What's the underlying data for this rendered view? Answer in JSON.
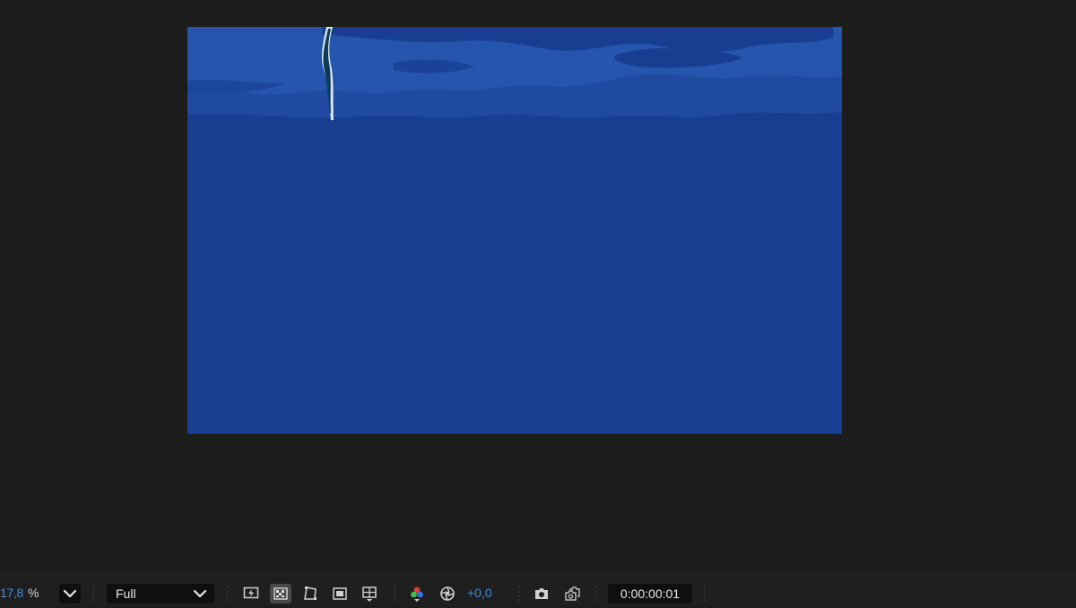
{
  "viewer": {
    "background": "#1d1d1d",
    "composition_color": "#173e91"
  },
  "toolbar": {
    "zoom_value": "17,8",
    "zoom_unit": "%",
    "resolution": "Full",
    "exposure": "+0,0",
    "timecode": "0:00:00:01",
    "icons": {
      "zoom_dropdown": "chevron-down-icon",
      "resolution_dropdown": "chevron-down-icon",
      "fast_preview": "fast-preview-icon",
      "transparency_grid": "transparency-grid-icon",
      "mask_visibility": "mask-path-icon",
      "region_of_interest": "region-of-interest-icon",
      "grid_guides": "grid-guides-icon",
      "channel": "rgb-channel-icon",
      "color_management": "color-management-icon",
      "snapshot": "camera-icon",
      "show_snapshot": "show-snapshot-icon"
    },
    "accent_color": "#3d8de0"
  }
}
